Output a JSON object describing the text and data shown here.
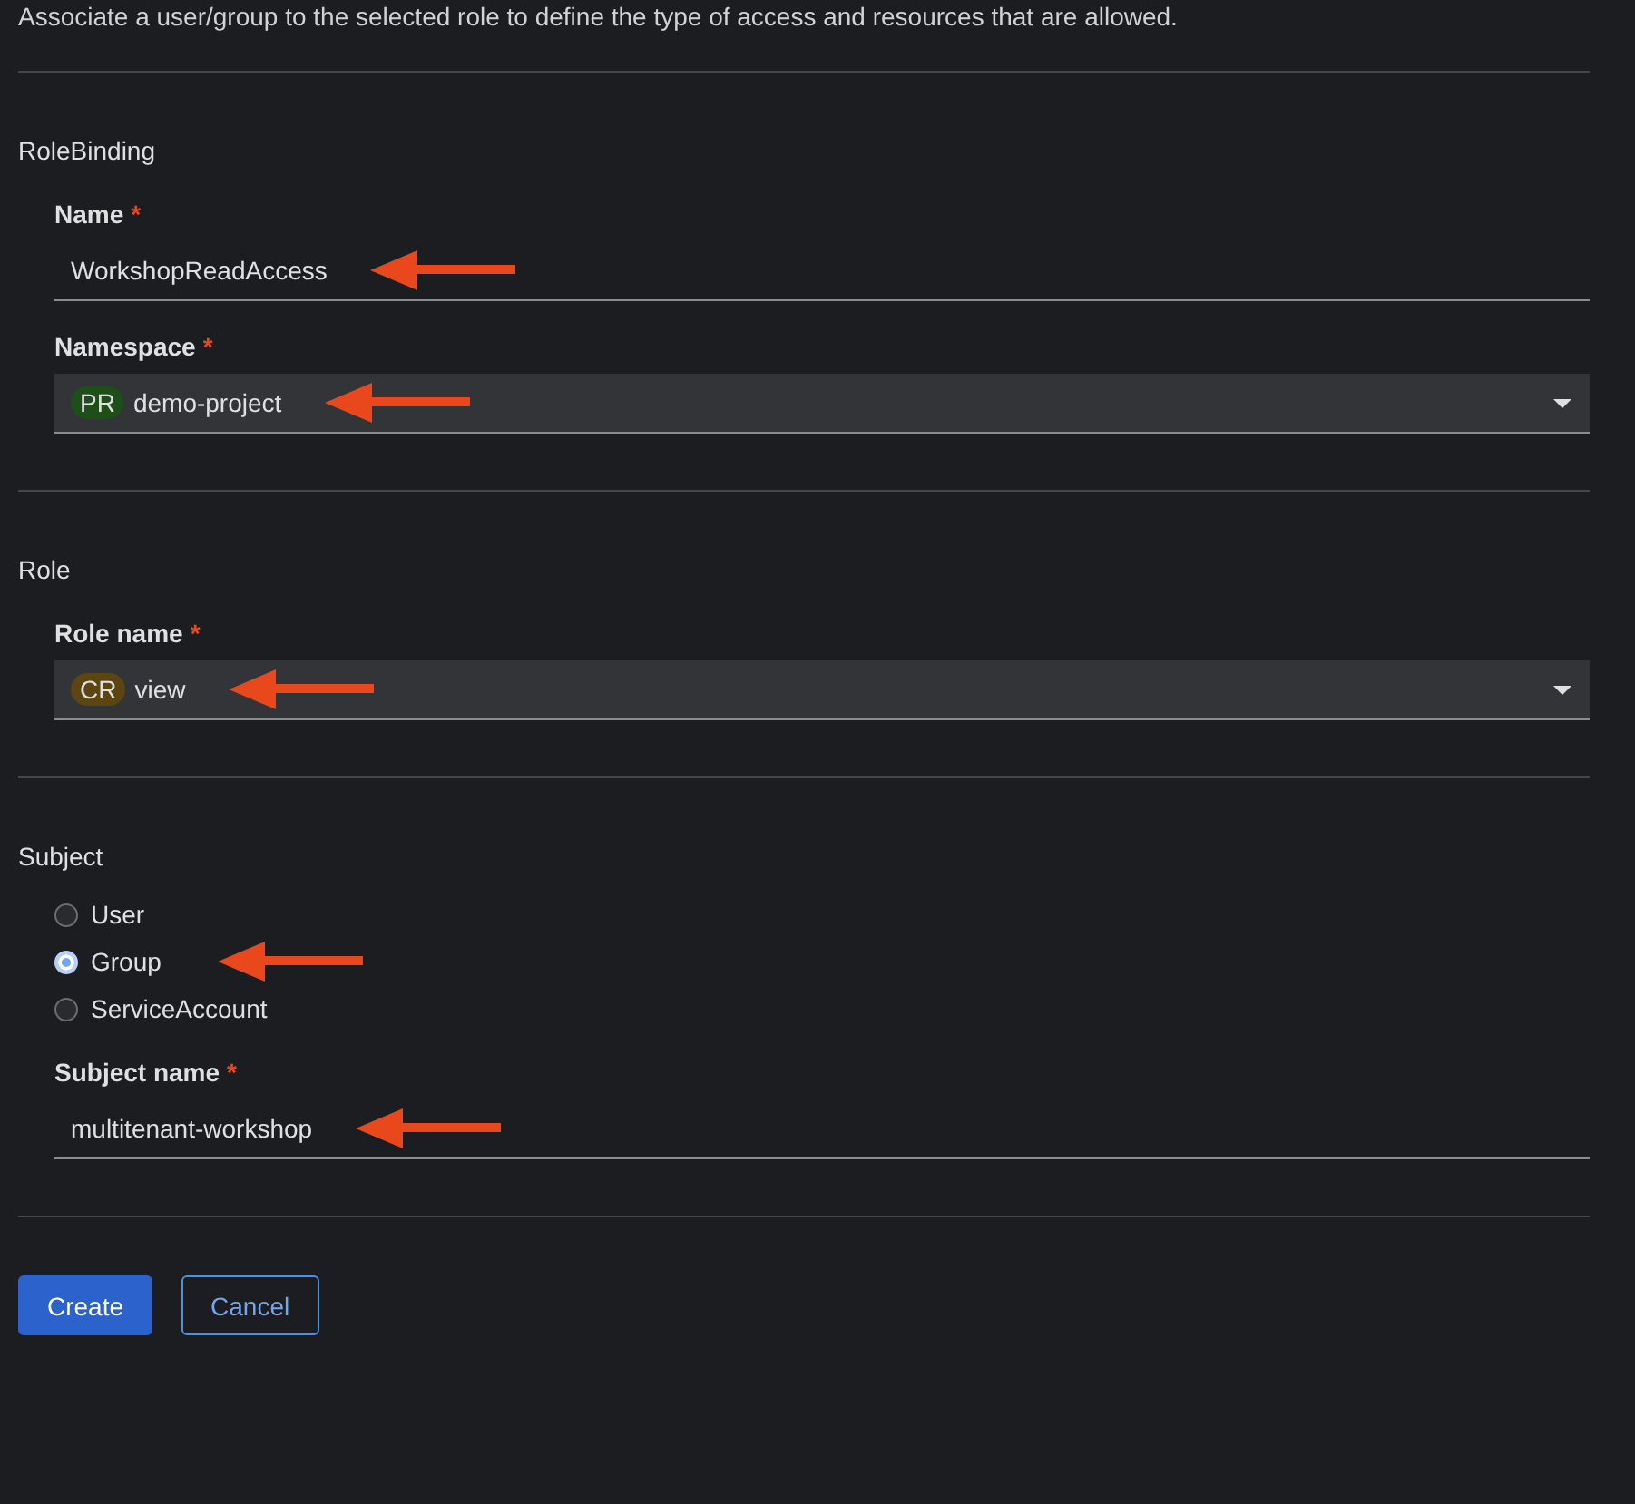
{
  "description": "Associate a user/group to the selected role to define the type of access and resources that are allowed.",
  "sections": [
    {
      "title": "RoleBinding",
      "fields": [
        {
          "kind": "text",
          "label": "Name",
          "required_mark": "*",
          "value": "WorkshopReadAccess",
          "annotated": true
        },
        {
          "kind": "select",
          "label": "Namespace",
          "required_mark": "*",
          "badge": "PR",
          "color": "#1e4f18",
          "value": "demo-project",
          "annotated": true
        }
      ]
    },
    {
      "title": "Role",
      "fields": [
        {
          "kind": "select",
          "label": "Role name",
          "required_mark": "*",
          "badge": "CR",
          "color": "#5c4511",
          "value": "view",
          "annotated": true
        }
      ]
    },
    {
      "title": "Subject",
      "fields": [
        {
          "kind": "radio-group",
          "options": [
            {
              "label": "User",
              "selected": false,
              "annotated": false
            },
            {
              "label": "Group",
              "selected": true,
              "annotated": true
            },
            {
              "label": "ServiceAccount",
              "selected": false,
              "annotated": false
            }
          ]
        },
        {
          "kind": "text",
          "label": "Subject name",
          "required_mark": "*",
          "value": "multitenant-workshop",
          "annotated": true
        }
      ]
    }
  ],
  "buttons": [
    {
      "label": "Create",
      "kind": "primary"
    },
    {
      "label": "Cancel",
      "kind": "secondary"
    }
  ]
}
